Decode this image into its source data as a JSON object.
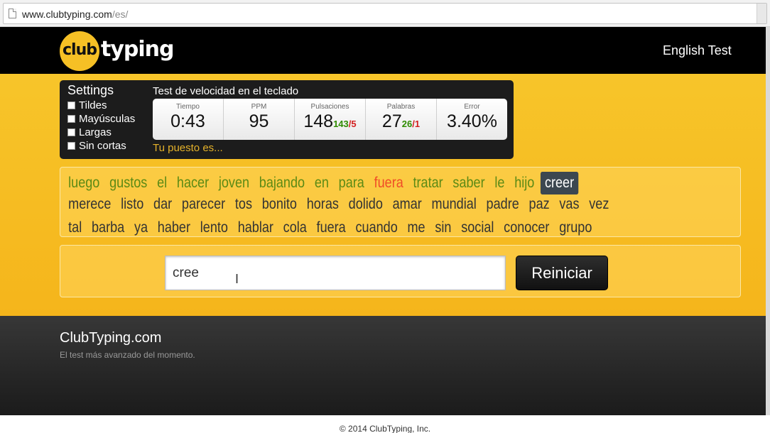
{
  "browser": {
    "url_domain": "www.clubtyping.com",
    "url_path": "/es/"
  },
  "header": {
    "logo_club": "club",
    "logo_typing": "typing",
    "english_test": "English Test"
  },
  "settings": {
    "title": "Settings",
    "options": [
      "Tildes",
      "Mayúsculas",
      "Largas",
      "Sin cortas"
    ]
  },
  "test": {
    "title": "Test de velocidad en el teclado",
    "metrics": [
      {
        "label": "Tiempo",
        "value": "0:43"
      },
      {
        "label": "PPM",
        "value": "95"
      },
      {
        "label": "Pulsaciones",
        "value": "148",
        "ok": "143",
        "sep": "/",
        "err": "5"
      },
      {
        "label": "Palabras",
        "value": "27",
        "ok": "26",
        "sep": "/",
        "err": "1"
      },
      {
        "label": "Error",
        "value": "3.40%"
      }
    ],
    "rank_link": "Tu puesto es..."
  },
  "words": {
    "lines": [
      [
        {
          "t": "luego",
          "s": "correct"
        },
        {
          "t": "gustos",
          "s": "correct"
        },
        {
          "t": "el",
          "s": "correct"
        },
        {
          "t": "hacer",
          "s": "correct"
        },
        {
          "t": "joven",
          "s": "correct"
        },
        {
          "t": "bajando",
          "s": "correct"
        },
        {
          "t": "en",
          "s": "correct"
        },
        {
          "t": "para",
          "s": "correct"
        },
        {
          "t": "fuera",
          "s": "wrong"
        },
        {
          "t": "tratar",
          "s": "correct"
        },
        {
          "t": "saber",
          "s": "correct"
        },
        {
          "t": "le",
          "s": "correct"
        },
        {
          "t": "hijo",
          "s": "correct"
        },
        {
          "t": "creer",
          "s": "current"
        }
      ],
      [
        {
          "t": "merece",
          "s": ""
        },
        {
          "t": "listo",
          "s": ""
        },
        {
          "t": "dar",
          "s": ""
        },
        {
          "t": "parecer",
          "s": ""
        },
        {
          "t": "tos",
          "s": ""
        },
        {
          "t": "bonito",
          "s": ""
        },
        {
          "t": "horas",
          "s": ""
        },
        {
          "t": "dolido",
          "s": ""
        },
        {
          "t": "amar",
          "s": ""
        },
        {
          "t": "mundial",
          "s": ""
        },
        {
          "t": "padre",
          "s": ""
        },
        {
          "t": "paz",
          "s": ""
        },
        {
          "t": "vas",
          "s": ""
        },
        {
          "t": "vez",
          "s": ""
        }
      ],
      [
        {
          "t": "tal",
          "s": ""
        },
        {
          "t": "barba",
          "s": ""
        },
        {
          "t": "ya",
          "s": ""
        },
        {
          "t": "haber",
          "s": ""
        },
        {
          "t": "lento",
          "s": ""
        },
        {
          "t": "hablar",
          "s": ""
        },
        {
          "t": "cola",
          "s": ""
        },
        {
          "t": "fuera",
          "s": ""
        },
        {
          "t": "cuando",
          "s": ""
        },
        {
          "t": "me",
          "s": ""
        },
        {
          "t": "sin",
          "s": ""
        },
        {
          "t": "social",
          "s": ""
        },
        {
          "t": "conocer",
          "s": ""
        },
        {
          "t": "grupo",
          "s": ""
        }
      ]
    ]
  },
  "input": {
    "value": "cree",
    "restart_label": "Reiniciar"
  },
  "footer": {
    "title": "ClubTyping.com",
    "subtitle": "El test más avanzado del momento.",
    "copyright": "© 2014 ClubTyping, Inc."
  },
  "colors": {
    "accent_yellow": "#f6c025",
    "correct_green": "#5b8a15",
    "wrong_red": "#f04c27",
    "current_bg": "#3c4750"
  }
}
